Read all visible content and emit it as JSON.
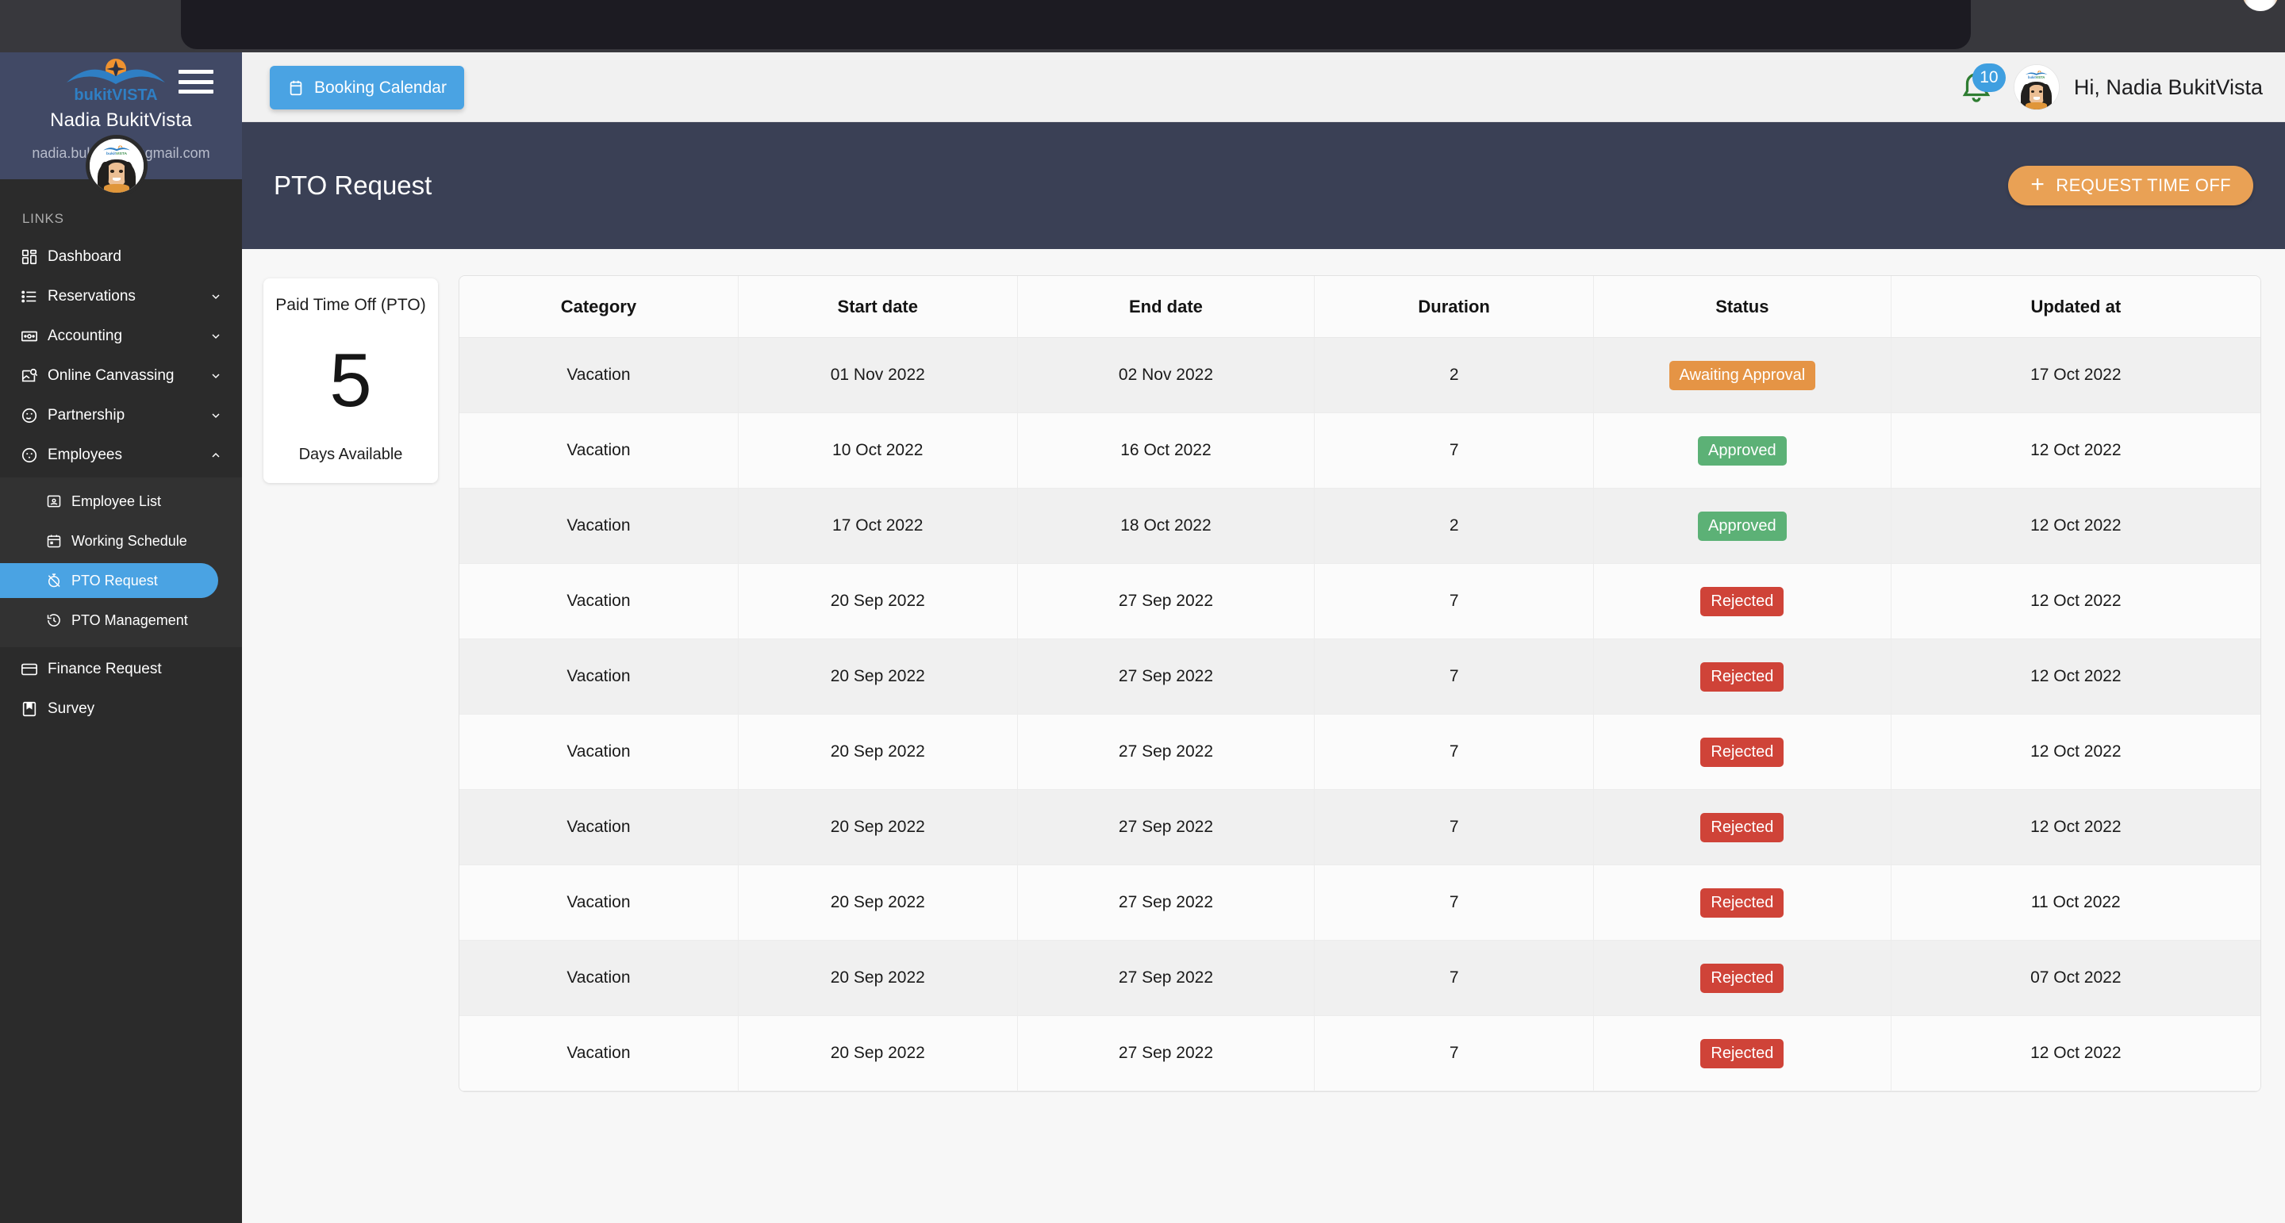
{
  "browser": {
    "tab_icon": "firefox-logo-icon"
  },
  "sidebar": {
    "brand": "bukitVISTA",
    "menu_icon": "hamburger-menu-icon",
    "user_name": "Nadia BukitVista",
    "user_email": "nadia.bukitvista@gmail.com",
    "avatar_icon": "user-avatar",
    "section_label": "LINKS",
    "items": [
      {
        "label": "Dashboard",
        "icon": "dashboard-grid-icon",
        "chevron": "",
        "level": "top"
      },
      {
        "label": "Reservations",
        "icon": "list-icon",
        "chevron": "down",
        "level": "top"
      },
      {
        "label": "Accounting",
        "icon": "money-icon",
        "chevron": "down",
        "level": "top"
      },
      {
        "label": "Online Canvassing",
        "icon": "image-search-icon",
        "chevron": "down",
        "level": "top"
      },
      {
        "label": "Partnership",
        "icon": "handshake-face-icon",
        "chevron": "down",
        "level": "top"
      },
      {
        "label": "Employees",
        "icon": "employees-face-icon",
        "chevron": "up",
        "level": "top"
      },
      {
        "label": "Employee List",
        "icon": "id-card-icon",
        "chevron": "",
        "level": "sub"
      },
      {
        "label": "Working Schedule",
        "icon": "calendar-icon",
        "chevron": "",
        "level": "sub"
      },
      {
        "label": "PTO Request",
        "icon": "stopwatch-off-icon",
        "chevron": "",
        "level": "sub",
        "active": true
      },
      {
        "label": "PTO Management",
        "icon": "history-clock-icon",
        "chevron": "",
        "level": "sub"
      },
      {
        "label": "Finance Request",
        "icon": "credit-card-icon",
        "chevron": "",
        "level": "top"
      },
      {
        "label": "Survey",
        "icon": "bookmark-book-icon",
        "chevron": "",
        "level": "top"
      }
    ]
  },
  "topbar": {
    "booking_label": "Booking Calendar",
    "booking_icon": "calendar-icon",
    "bell_icon": "notification-bell-icon",
    "notification_count": "10",
    "avatar_icon": "user-avatar",
    "greeting": "Hi, Nadia BukitVista"
  },
  "page": {
    "title": "PTO Request",
    "request_button": "REQUEST TIME OFF",
    "request_button_icon": "plus-icon"
  },
  "pto_card": {
    "title": "Paid Time Off (PTO)",
    "value": "5",
    "subtitle": "Days Available"
  },
  "table": {
    "columns": [
      "Category",
      "Start date",
      "End date",
      "Duration",
      "Status",
      "Updated at"
    ],
    "rows": [
      {
        "category": "Vacation",
        "start": "01 Nov 2022",
        "end": "02 Nov 2022",
        "duration": "2",
        "status": "Awaiting Approval",
        "status_kind": "awaiting",
        "updated": "17 Oct 2022"
      },
      {
        "category": "Vacation",
        "start": "10 Oct 2022",
        "end": "16 Oct 2022",
        "duration": "7",
        "status": "Approved",
        "status_kind": "approved",
        "updated": "12 Oct 2022"
      },
      {
        "category": "Vacation",
        "start": "17 Oct 2022",
        "end": "18 Oct 2022",
        "duration": "2",
        "status": "Approved",
        "status_kind": "approved",
        "updated": "12 Oct 2022"
      },
      {
        "category": "Vacation",
        "start": "20 Sep 2022",
        "end": "27 Sep 2022",
        "duration": "7",
        "status": "Rejected",
        "status_kind": "rejected",
        "updated": "12 Oct 2022"
      },
      {
        "category": "Vacation",
        "start": "20 Sep 2022",
        "end": "27 Sep 2022",
        "duration": "7",
        "status": "Rejected",
        "status_kind": "rejected",
        "updated": "12 Oct 2022"
      },
      {
        "category": "Vacation",
        "start": "20 Sep 2022",
        "end": "27 Sep 2022",
        "duration": "7",
        "status": "Rejected",
        "status_kind": "rejected",
        "updated": "12 Oct 2022"
      },
      {
        "category": "Vacation",
        "start": "20 Sep 2022",
        "end": "27 Sep 2022",
        "duration": "7",
        "status": "Rejected",
        "status_kind": "rejected",
        "updated": "12 Oct 2022"
      },
      {
        "category": "Vacation",
        "start": "20 Sep 2022",
        "end": "27 Sep 2022",
        "duration": "7",
        "status": "Rejected",
        "status_kind": "rejected",
        "updated": "11 Oct 2022"
      },
      {
        "category": "Vacation",
        "start": "20 Sep 2022",
        "end": "27 Sep 2022",
        "duration": "7",
        "status": "Rejected",
        "status_kind": "rejected",
        "updated": "07 Oct 2022"
      },
      {
        "category": "Vacation",
        "start": "20 Sep 2022",
        "end": "27 Sep 2022",
        "duration": "7",
        "status": "Rejected",
        "status_kind": "rejected",
        "updated": "12 Oct 2022"
      }
    ]
  },
  "colors": {
    "accent_blue": "#4aa3e3",
    "sidebar_dark": "#2b2b2b",
    "sidebar_head": "#414965",
    "banner": "#3a4055",
    "orange": "#e9a155",
    "status_awaiting": "#e59445",
    "status_approved": "#5cb176",
    "status_rejected": "#cf4338"
  }
}
